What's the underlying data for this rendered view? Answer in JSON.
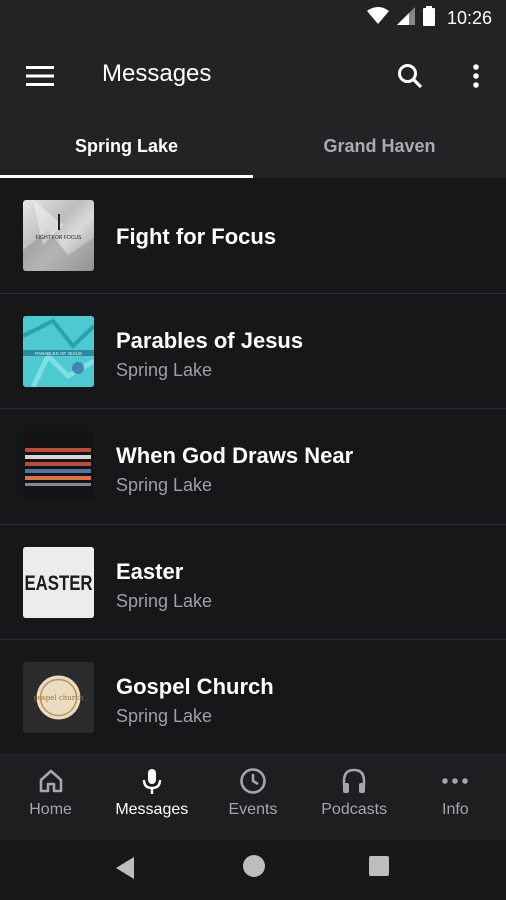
{
  "status_bar": {
    "time": "10:26",
    "icons": [
      "wifi-icon",
      "signal-icon",
      "battery-icon"
    ]
  },
  "app_bar": {
    "title": "Messages",
    "icons": [
      "menu-icon",
      "search-icon",
      "more-vert-icon"
    ]
  },
  "tabs": [
    {
      "label": "Spring Lake",
      "active": true
    },
    {
      "label": "Grand Haven",
      "active": false
    }
  ],
  "items": [
    {
      "title": "Fight for Focus",
      "subtitle": "",
      "thumb_text": "FIGHT FOR FOCUS"
    },
    {
      "title": "Parables of Jesus",
      "subtitle": "Spring Lake",
      "thumb_text": "PARABLES OF JESUS"
    },
    {
      "title": "When God Draws Near",
      "subtitle": "Spring Lake",
      "thumb_text": ""
    },
    {
      "title": "Easter",
      "subtitle": "Spring Lake",
      "thumb_text": "EASTER"
    },
    {
      "title": "Gospel Church",
      "subtitle": "Spring Lake",
      "thumb_text": "gospel church"
    }
  ],
  "bottom_nav": [
    {
      "label": "Home",
      "icon": "home-icon",
      "active": false
    },
    {
      "label": "Messages",
      "icon": "microphone-icon",
      "active": true
    },
    {
      "label": "Events",
      "icon": "clock-icon",
      "active": false
    },
    {
      "label": "Podcasts",
      "icon": "headphones-icon",
      "active": false
    },
    {
      "label": "Info",
      "icon": "more-horiz-icon",
      "active": false
    }
  ],
  "colors": {
    "background": "#161719",
    "app_bar": "#222325",
    "active_tab_indicator": "#ffffff",
    "inactive_text": "#a4a6a9"
  }
}
